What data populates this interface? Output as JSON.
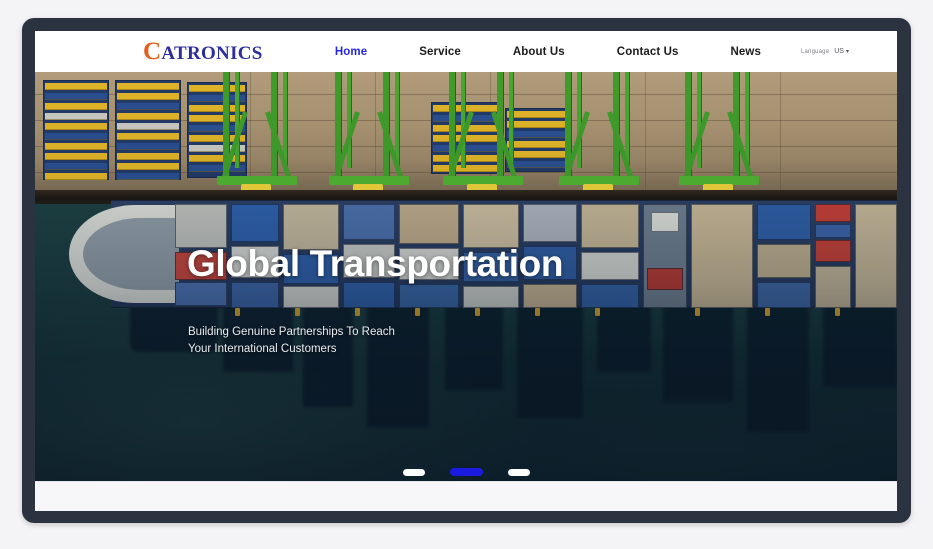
{
  "browser": {
    "page_background": "#f4f4f7",
    "frame_color": "#2b3340"
  },
  "header": {
    "logo": {
      "initial": "C",
      "rest": "ATRONICS",
      "initial_color": "#e2601f",
      "rest_color": "#2d2d9c"
    },
    "nav": [
      {
        "label": "Home",
        "active": true
      },
      {
        "label": "Service",
        "active": false
      },
      {
        "label": "About Us",
        "active": false
      },
      {
        "label": "Contact Us",
        "active": false
      },
      {
        "label": "News",
        "active": false
      }
    ],
    "language": {
      "label": "Language",
      "value": "US",
      "caret": "▾"
    },
    "active_color": "#2727e0"
  },
  "hero": {
    "title": "Global Transportation",
    "subtitle_line1": "Building Genuine Partnerships To Reach",
    "subtitle_line2": "Your International  Customers",
    "image_alt": "aerial-view-container-ship-at-port",
    "carousel": {
      "slides": [
        {
          "name": "slide-1",
          "active": false
        },
        {
          "name": "slide-2",
          "active": true
        },
        {
          "name": "slide-3",
          "active": false
        }
      ],
      "active_color": "#1a1ae0",
      "inactive_color": "#ffffff"
    }
  },
  "footer": {
    "background": "#f7f7fa"
  }
}
